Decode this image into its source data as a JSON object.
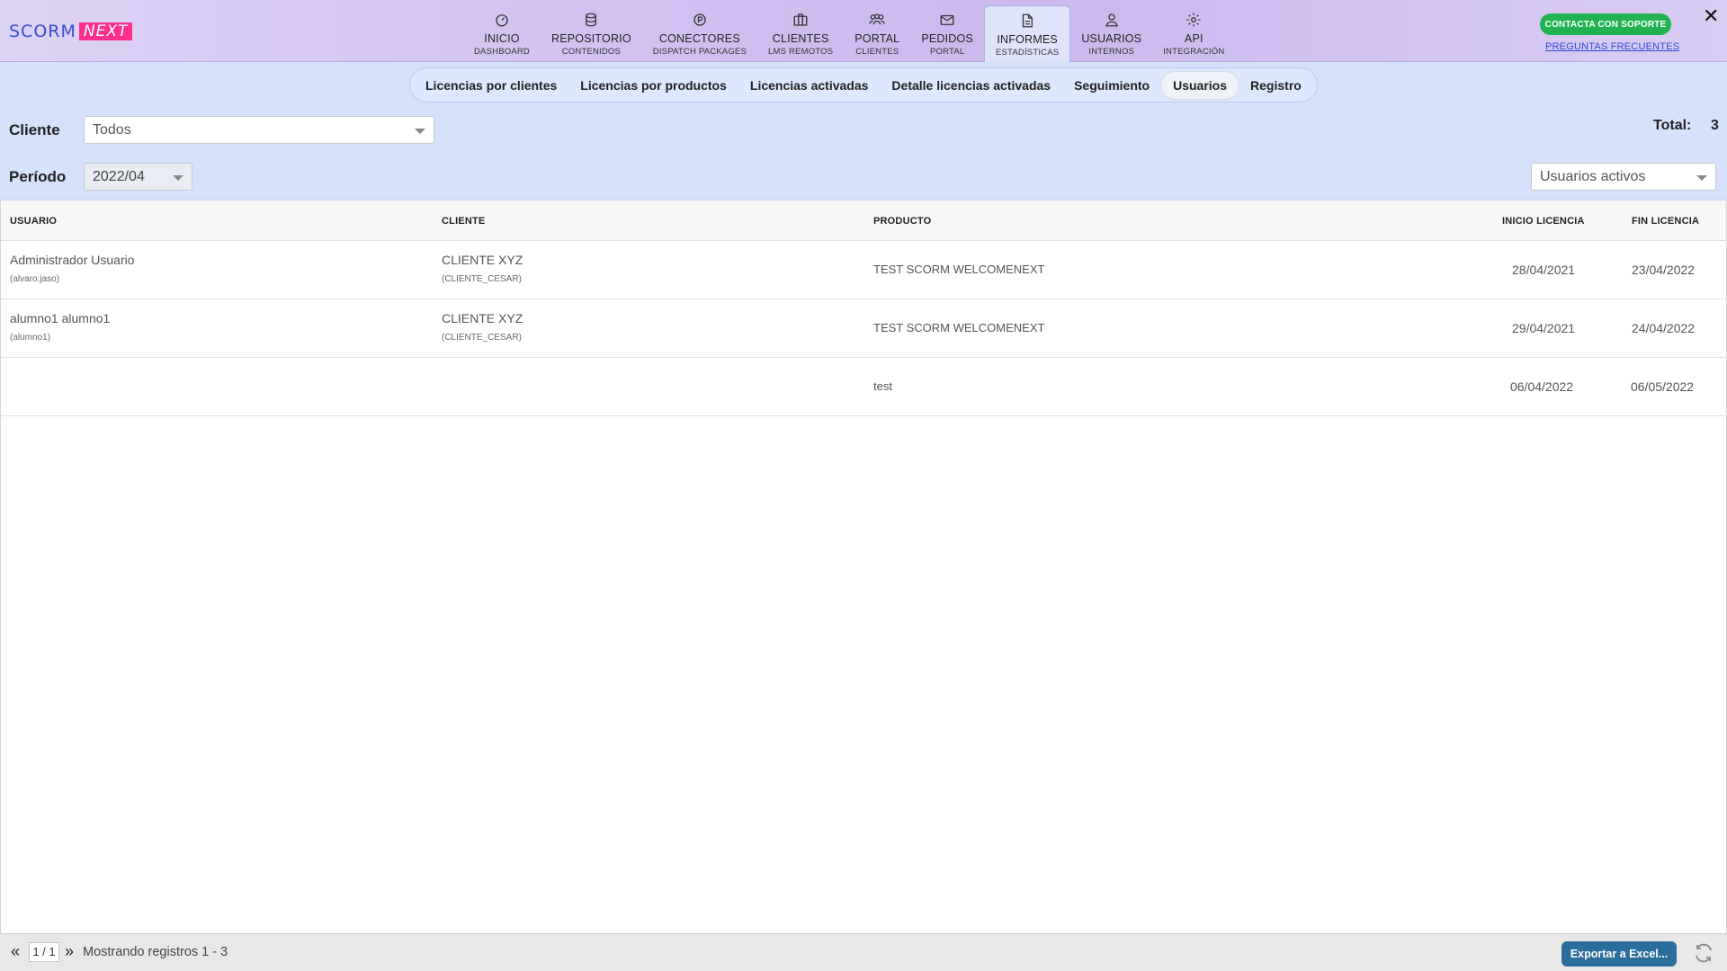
{
  "brand": {
    "part1": "SCORM",
    "part2": "NEXT"
  },
  "nav": [
    {
      "title": "INICIO",
      "sub": "DASHBOARD",
      "icon": "gauge-icon"
    },
    {
      "title": "REPOSITORIO",
      "sub": "CONTENIDOS",
      "icon": "database-icon"
    },
    {
      "title": "CONECTORES",
      "sub": "DISPATCH PACKAGES",
      "icon": "dispatch-icon"
    },
    {
      "title": "CLIENTES",
      "sub": "LMS REMOTOS",
      "icon": "briefcase-icon"
    },
    {
      "title": "PORTAL",
      "sub": "CLIENTES",
      "icon": "users-icon"
    },
    {
      "title": "PEDIDOS",
      "sub": "PORTAL",
      "icon": "mail-icon"
    },
    {
      "title": "INFORMES",
      "sub": "ESTADÍSTICAS",
      "icon": "document-icon"
    },
    {
      "title": "USUARIOS",
      "sub": "INTERNOS",
      "icon": "user-icon"
    },
    {
      "title": "API",
      "sub": "INTEGRACIÓN",
      "icon": "gear-icon"
    }
  ],
  "header": {
    "support_label": "CONTACTA CON SOPORTE",
    "faq_label": "PREGUNTAS FRECUENTES",
    "close_glyph": "✕"
  },
  "subtabs": [
    "Licencias por clientes",
    "Licencias por productos",
    "Licencias activadas",
    "Detalle licencias activadas",
    "Seguimiento",
    "Usuarios",
    "Registro"
  ],
  "filters": {
    "cliente_label": "Cliente",
    "cliente_value": "Todos",
    "periodo_label": "Período",
    "periodo_value": "2022/04",
    "users_filter_value": "Usuarios activos",
    "total_label": "Total:",
    "total_value": "3"
  },
  "table": {
    "columns": [
      "USUARIO",
      "CLIENTE",
      "PRODUCTO",
      "INICIO LICENCIA",
      "FIN LICENCIA"
    ],
    "rows": [
      {
        "user": "Administrador Usuario",
        "user_login": "(alvaro.jaso)",
        "client": "CLIENTE XYZ",
        "client_code": "(CLIENTE_CESAR)",
        "product": "TEST SCORM WELCOMENEXT",
        "start": "28/04/2021",
        "end": "23/04/2022"
      },
      {
        "user": "alumno1 alumno1",
        "user_login": "(alumno1)",
        "client": "CLIENTE XYZ",
        "client_code": "(CLIENTE_CESAR)",
        "product": "TEST SCORM WELCOMENEXT",
        "start": "29/04/2021",
        "end": "24/04/2022"
      },
      {
        "user": "",
        "user_login": "",
        "client": "",
        "client_code": "",
        "product": "test",
        "start": "06/04/2022",
        "end": "06/05/2022"
      }
    ]
  },
  "footer": {
    "prev_glyph": "«",
    "page": "1 / 1",
    "next_glyph": "»",
    "records_text": "Mostrando registros 1 - 3",
    "export_label": "Exportar a Excel..."
  },
  "colors": {
    "accent_pink": "#ff2f8e",
    "brand_blue": "#3a4bd0",
    "support_green": "#21b34f",
    "export_blue": "#2b6e9c",
    "filter_bg": "#d6e2fc"
  }
}
